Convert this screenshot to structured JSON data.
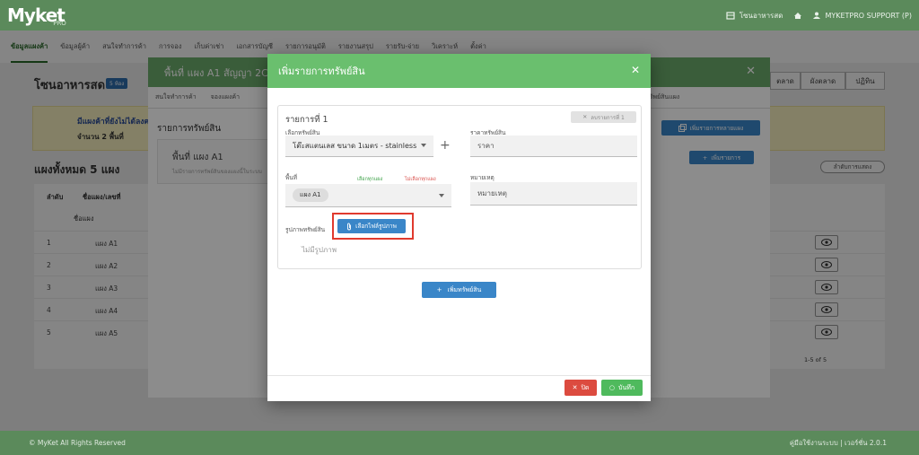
{
  "app": {
    "logo": "Myket",
    "logo_sub": "PRO"
  },
  "topbar": {
    "market_name": "โซนอาหารสด",
    "user": "MYKETPRO SUPPORT (P)"
  },
  "nav": {
    "tabs": [
      "ข้อมูลแผงค้า",
      "ข้อมูลผู้ค้า",
      "สนใจทำการค้า",
      "การจอง",
      "เก็บค่าเช่า",
      "เอกสารบัญชี",
      "รายการอนุมัติ",
      "รายงานสรุป",
      "รายรับ-จ่าย",
      "วิเคราะห์",
      "ตั้งค่า"
    ]
  },
  "page": {
    "title": "โซนอาหารสด",
    "badge": "5 ห้อง",
    "seg_buttons": [
      "ตลาด",
      "ผังตลาด",
      "ปฏิทิน"
    ],
    "alert_title": "มีแผงค้าที่ยังไม่ได้ลงคอง",
    "alert_sub": "จำนวน 2 พื้นที่",
    "section_title": "แผงทั้งหมด 5 แผง",
    "sort_button": "ลำดับการแสดง",
    "table_headers": [
      "ลำดับ",
      "ชื่อแผง/เลขที่"
    ],
    "filter_placeholder": "ชื่อแผง",
    "rows": [
      {
        "num": "1",
        "name": "แผง A1"
      },
      {
        "num": "2",
        "name": "แผง A2"
      },
      {
        "num": "3",
        "name": "แผง A3"
      },
      {
        "num": "4",
        "name": "แผง A4"
      },
      {
        "num": "5",
        "name": "แผง A5"
      }
    ],
    "pager": "1-5 of 5"
  },
  "mid_modal": {
    "title": "พื้นที่ แผง A1 สัญญา 2C",
    "tabs": [
      "สนใจทำการค้า",
      "จองแผงค้า",
      "ทรัพย์สินแผง"
    ],
    "list_title": "รายการทรัพย์สิน",
    "card_title": "พื้นที่ แผง A1",
    "card_sub": "ไม่มีรายการทรัพย์สินของแผงนี้ในระบบ",
    "btn_multi": "เพิ่มรายการหลายแผง",
    "btn_add": "เพิ่มรายการ"
  },
  "modal": {
    "title": "เพิ่มรายการทรัพย์สิน",
    "item_title": "รายการที่ 1",
    "delete_item": "ลบรายการที่ 1",
    "asset_label": "เลือกทรัพย์สิน",
    "asset_value": "โต๊ะสแตนเลส ขนาด 1เมตร - stainless",
    "price_label": "ราคาทรัพย์สิน",
    "price_placeholder": "ราคา",
    "area_label": "พื้นที่",
    "select_all": "เลือกทุกแผง",
    "deselect_all": "ไม่เลือกทุกแผง",
    "area_chip": "แผง A1",
    "note_label": "หมายเหตุ",
    "note_placeholder": "หมายเหตุ",
    "image_label": "รูปภาพทรัพย์สิน",
    "file_button": "เลือกไฟล์รูปภาพ",
    "no_image": "ไม่มีรูปภาพ",
    "add_asset": "เพิ่มทรัพย์สิน",
    "close_button": "ปิด",
    "save_button": "บันทึก"
  },
  "footer": {
    "left": "© MyKet All Rights Reserved",
    "right": "คู่มือใช้งานระบบ | เวอร์ชั่น 2.0.1"
  },
  "colors": {
    "header_green": "#5b8a5b",
    "modal_green": "#6abf6e",
    "primary_blue": "#3a86c8",
    "danger_red": "#dc4b3f",
    "success_green": "#4fba5d",
    "highlight": "#e03a2e"
  }
}
